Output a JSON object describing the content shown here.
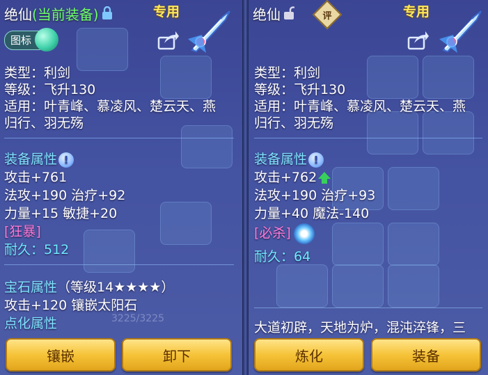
{
  "left": {
    "title_name": "绝仙",
    "title_current": "(当前装备)",
    "badge": "专用",
    "icon_button_label": "图标",
    "type_line": "类型：利剑",
    "level_line": "等级：飞升130",
    "apply_line1": "适用：叶青峰、慕凌风、楚云天、燕",
    "apply_line2": "归行、羽无殇",
    "attr_header": "装备属性",
    "attack": "攻击+761",
    "magic_heal": "法攻+190 治疗+92",
    "str_agi": "力量+15 敏捷+20",
    "special": "[狂暴]",
    "durability": "耐久：512",
    "gem_header": "宝石属性",
    "gem_level": "（等级14★★★★）",
    "gem_attack": "攻击+120 镶嵌太阳石",
    "dianhua_header": "点化属性",
    "btn_inlay": "镶嵌",
    "btn_remove": "卸下",
    "bg_hp": "3225/3225"
  },
  "right": {
    "title_name": "绝仙",
    "badge": "专用",
    "ping": "评",
    "type_line": "类型：利剑",
    "level_line": "等级：飞升130",
    "apply_line1": "适用：叶青峰、慕凌风、楚云天、燕",
    "apply_line2": "归行、羽无殇",
    "attr_header": "装备属性",
    "attack": "攻击+762",
    "magic_heal": "法攻+190 治疗+93",
    "str_mag": "力量+40 魔法-140",
    "special": "[必杀]",
    "durability": "耐久：64",
    "desc": "大道初辟，天地为炉，混沌淬锋，三",
    "btn_refine": "炼化",
    "btn_equip": "装备"
  },
  "colors": {
    "green_title": "#6dff6a",
    "section_cyan": "#7fe3ff",
    "special_pink": "#ff7ad8",
    "badge_yellow": "#ffe95a",
    "button_gold": "#f6c338"
  },
  "icons": [
    "lock-icon",
    "unlock-icon",
    "share-icon",
    "weapon-sword-icon",
    "info-icon",
    "up-arrow-icon",
    "skill-icon",
    "orb-icon"
  ]
}
